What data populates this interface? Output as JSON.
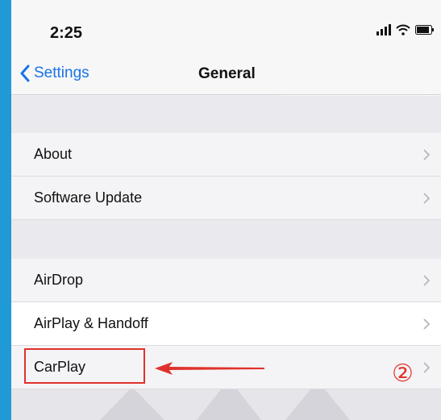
{
  "status_bar": {
    "time": "2:25"
  },
  "nav": {
    "back_label": "Settings",
    "title": "General"
  },
  "groups": [
    {
      "items": [
        "About",
        "Software Update"
      ]
    },
    {
      "items": [
        "AirDrop",
        "AirPlay & Handoff",
        "CarPlay"
      ]
    }
  ],
  "annotation": {
    "step": "②"
  },
  "colors": {
    "accent": "#1a73e8",
    "annotation": "#e0322c",
    "frame": "#1f9ad6"
  },
  "icons": [
    "signal-icon",
    "wifi-icon",
    "battery-icon",
    "back-chevron-icon",
    "chevron-right-icon"
  ]
}
